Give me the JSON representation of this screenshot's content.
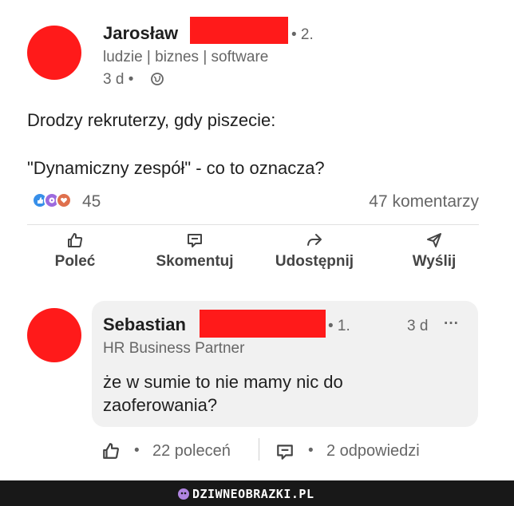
{
  "post": {
    "author": "Jarosław",
    "connection_degree": "• 2.",
    "headline": "ludzie | biznes | software",
    "time": "3 d •",
    "line1": "Drodzy rekruterzy, gdy piszecie:",
    "line2": "\"Dynamiczny zespół\" - co to oznacza?",
    "reaction_count": "45",
    "comments_count": "47 komentarzy"
  },
  "actions": {
    "like": "Poleć",
    "comment": "Skomentuj",
    "share": "Udostępnij",
    "send": "Wyślij"
  },
  "comment": {
    "author": "Sebastian",
    "connection_degree": "• 1.",
    "time": "3 d",
    "more": "···",
    "headline": "HR Business Partner",
    "line1": "że w sumie to nie mamy nic do",
    "line2": "zaoferowania?",
    "likes": "22 poleceń",
    "replies": "2 odpowiedzi",
    "separator": "•"
  },
  "footer": {
    "brand": "DZIWNEOBRAZKI.PL"
  },
  "colors": {
    "redaction": "#ff1a1a",
    "footer_bg": "#181818"
  }
}
